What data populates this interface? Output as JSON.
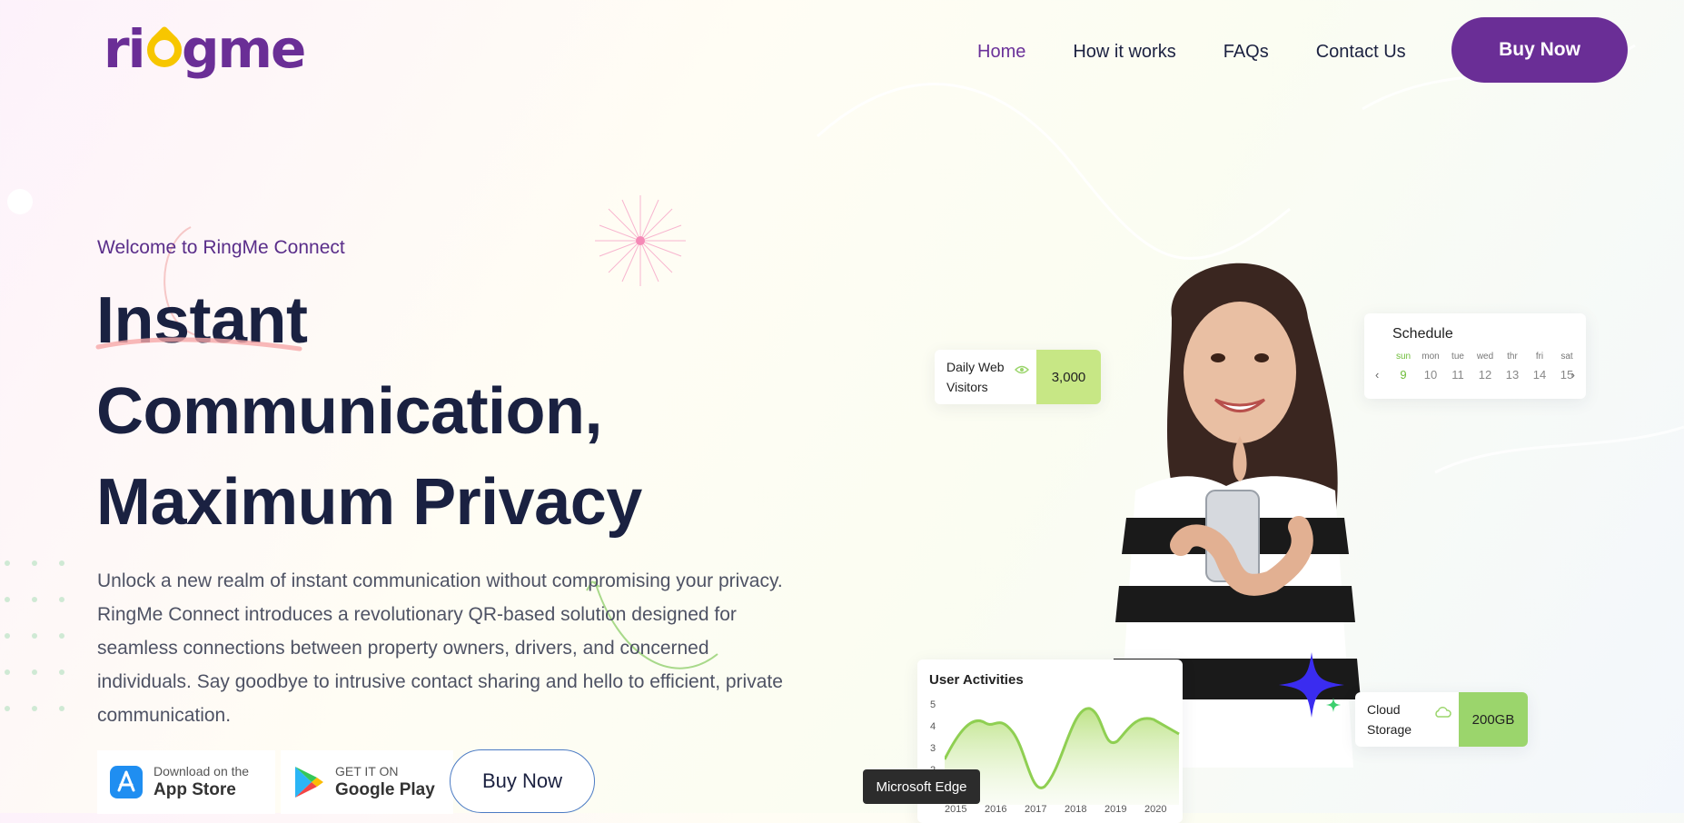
{
  "brand": {
    "logo_text": "ringme"
  },
  "nav": {
    "items": [
      "Home",
      "How it works",
      "FAQs",
      "Contact Us"
    ],
    "active": "Home"
  },
  "header": {
    "buy_label": "Buy Now"
  },
  "hero": {
    "welcome": "Welcome to RingMe Connect",
    "headline": [
      "Instant",
      "Communication,",
      "Maximum Privacy"
    ],
    "description": "Unlock a new realm of instant communication without compromising your privacy. RingMe Connect introduces a revolutionary QR-based solution designed for seamless connections between property owners, drivers, and concerned individuals. Say goodbye to intrusive contact sharing and hello to efficient, private communication.",
    "app_store": {
      "small": "Download on the",
      "big": "App Store"
    },
    "google_play": {
      "small": "GET IT ON",
      "big": "Google Play"
    },
    "buy_label": "Buy Now"
  },
  "widgets": {
    "visitors": {
      "label_line1": "Daily Web",
      "label_line2": "Visitors",
      "value": "3,000"
    },
    "schedule": {
      "title": "Schedule",
      "days": [
        "sun",
        "mon",
        "tue",
        "wed",
        "thr",
        "fri",
        "sat"
      ],
      "dates": [
        "9",
        "10",
        "11",
        "12",
        "13",
        "14",
        "15"
      ],
      "current_index": 0
    },
    "user_activities": {
      "title": "User Activities",
      "y_ticks": [
        "5",
        "4",
        "3",
        "2"
      ],
      "x_ticks": [
        "2015",
        "2016",
        "2017",
        "2018",
        "2019",
        "2020"
      ]
    },
    "storage": {
      "label_line1": "Cloud",
      "label_line2": "Storage",
      "value": "200GB"
    }
  },
  "tooltip": {
    "text": "Microsoft Edge"
  },
  "colors": {
    "brand_purple": "#6a2e96",
    "accent_yellow": "#f7c600",
    "accent_green": "#c7e785",
    "headline": "#1a2141"
  }
}
